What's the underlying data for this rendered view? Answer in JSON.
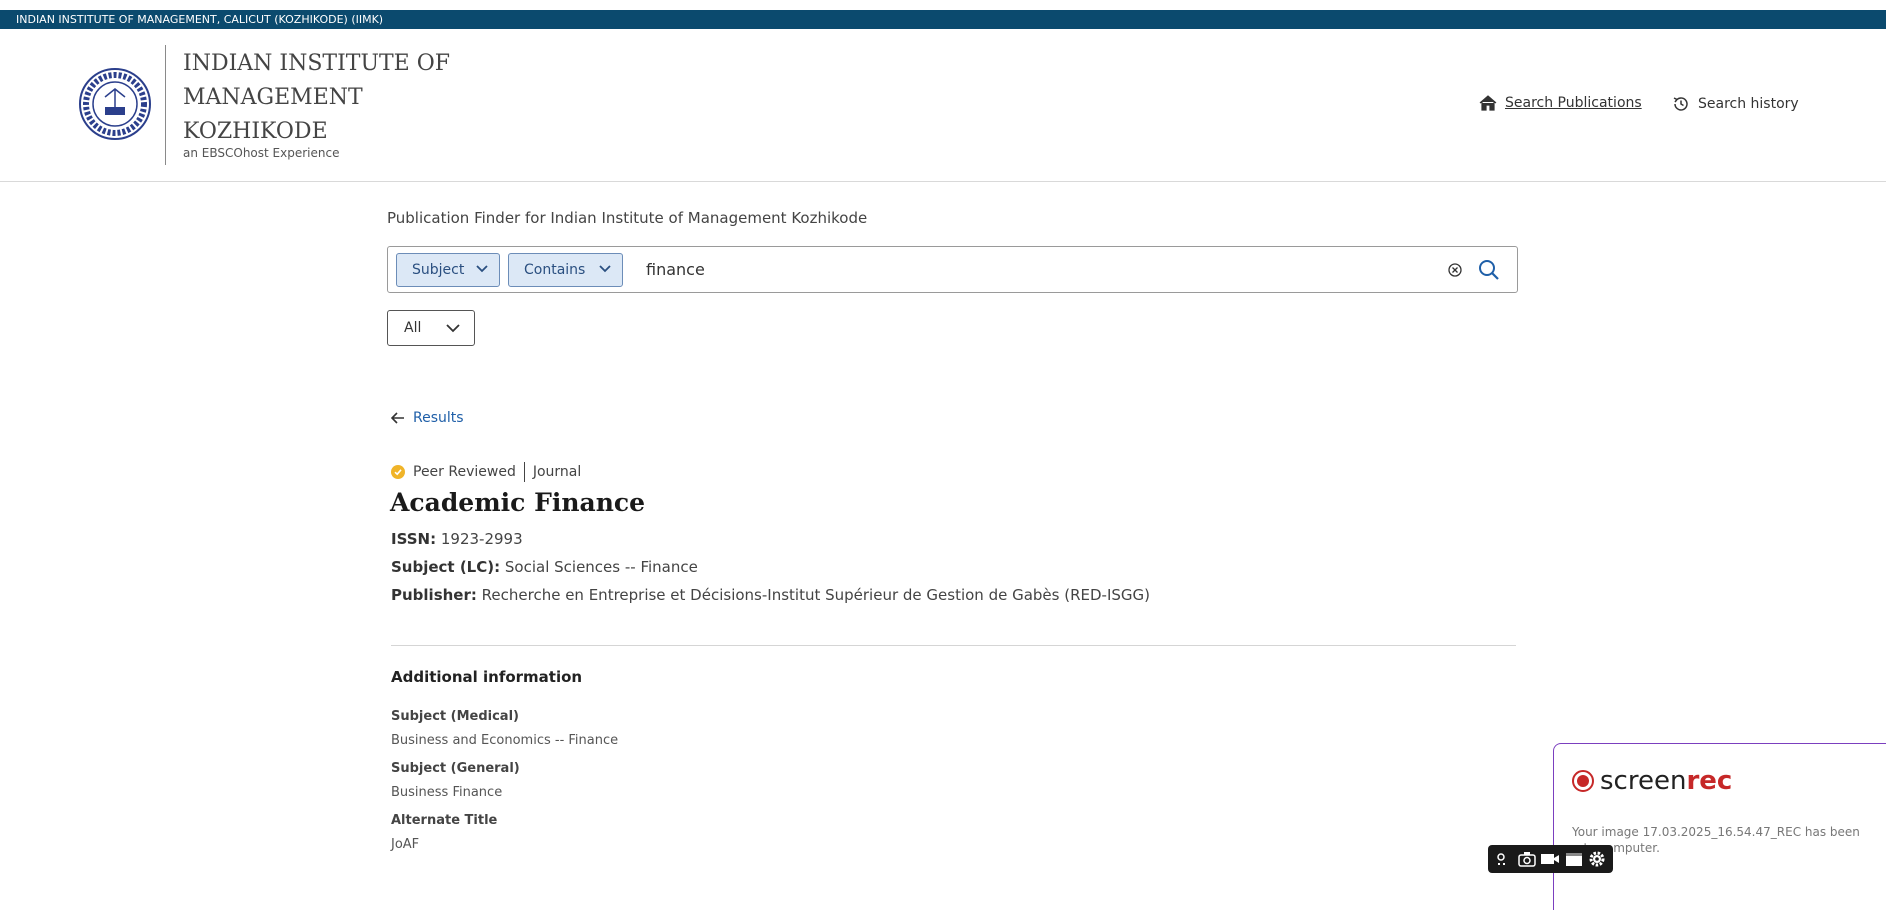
{
  "topbar": {
    "text": "INDIAN INSTITUTE OF MANAGEMENT, CALICUT (KOZHIKODE) (IIMK)"
  },
  "header": {
    "institution_name": "INDIAN INSTITUTE OF MANAGEMENT KOZHIKODE",
    "subtitle": "an EBSCOhost Experience",
    "nav": [
      {
        "label": "Search Publications",
        "icon": "home-icon"
      },
      {
        "label": "Search history",
        "icon": "history-icon"
      }
    ]
  },
  "finder": {
    "title": "Publication Finder for Indian Institute of Management Kozhikode",
    "field_selector": "Subject",
    "operator_selector": "Contains",
    "query": "finance",
    "scope": "All"
  },
  "back_link": {
    "label": "Results"
  },
  "publication": {
    "badge": "Peer Reviewed",
    "type": "Journal",
    "title": "Academic Finance",
    "fields": [
      {
        "label": "ISSN:",
        "value": "1923-2993"
      },
      {
        "label": "Subject (LC):",
        "value": "Social Sciences -- Finance"
      },
      {
        "label": "Publisher:",
        "value": "Recherche en Entreprise et Décisions-Institut Supérieur de Gestion de Gabès (RED-ISGG)"
      }
    ]
  },
  "additional": {
    "heading": "Additional information",
    "items": [
      {
        "label": "Subject (Medical)",
        "value": "Business and Economics -- Finance"
      },
      {
        "label": "Subject (General)",
        "value": "Business Finance"
      },
      {
        "label": "Alternate Title",
        "value": "JoAF"
      }
    ]
  },
  "screenrec": {
    "brand_a": "screen",
    "brand_b": "rec",
    "message": "Your image 17.03.2025_16.54.47_REC has been ...to computer."
  },
  "colors": {
    "topbar": "#0b4a6e",
    "pill_bg": "#dce8f6",
    "link": "#1f5fa8",
    "badge": "#f0b429",
    "screenrec_red": "#c62828"
  }
}
